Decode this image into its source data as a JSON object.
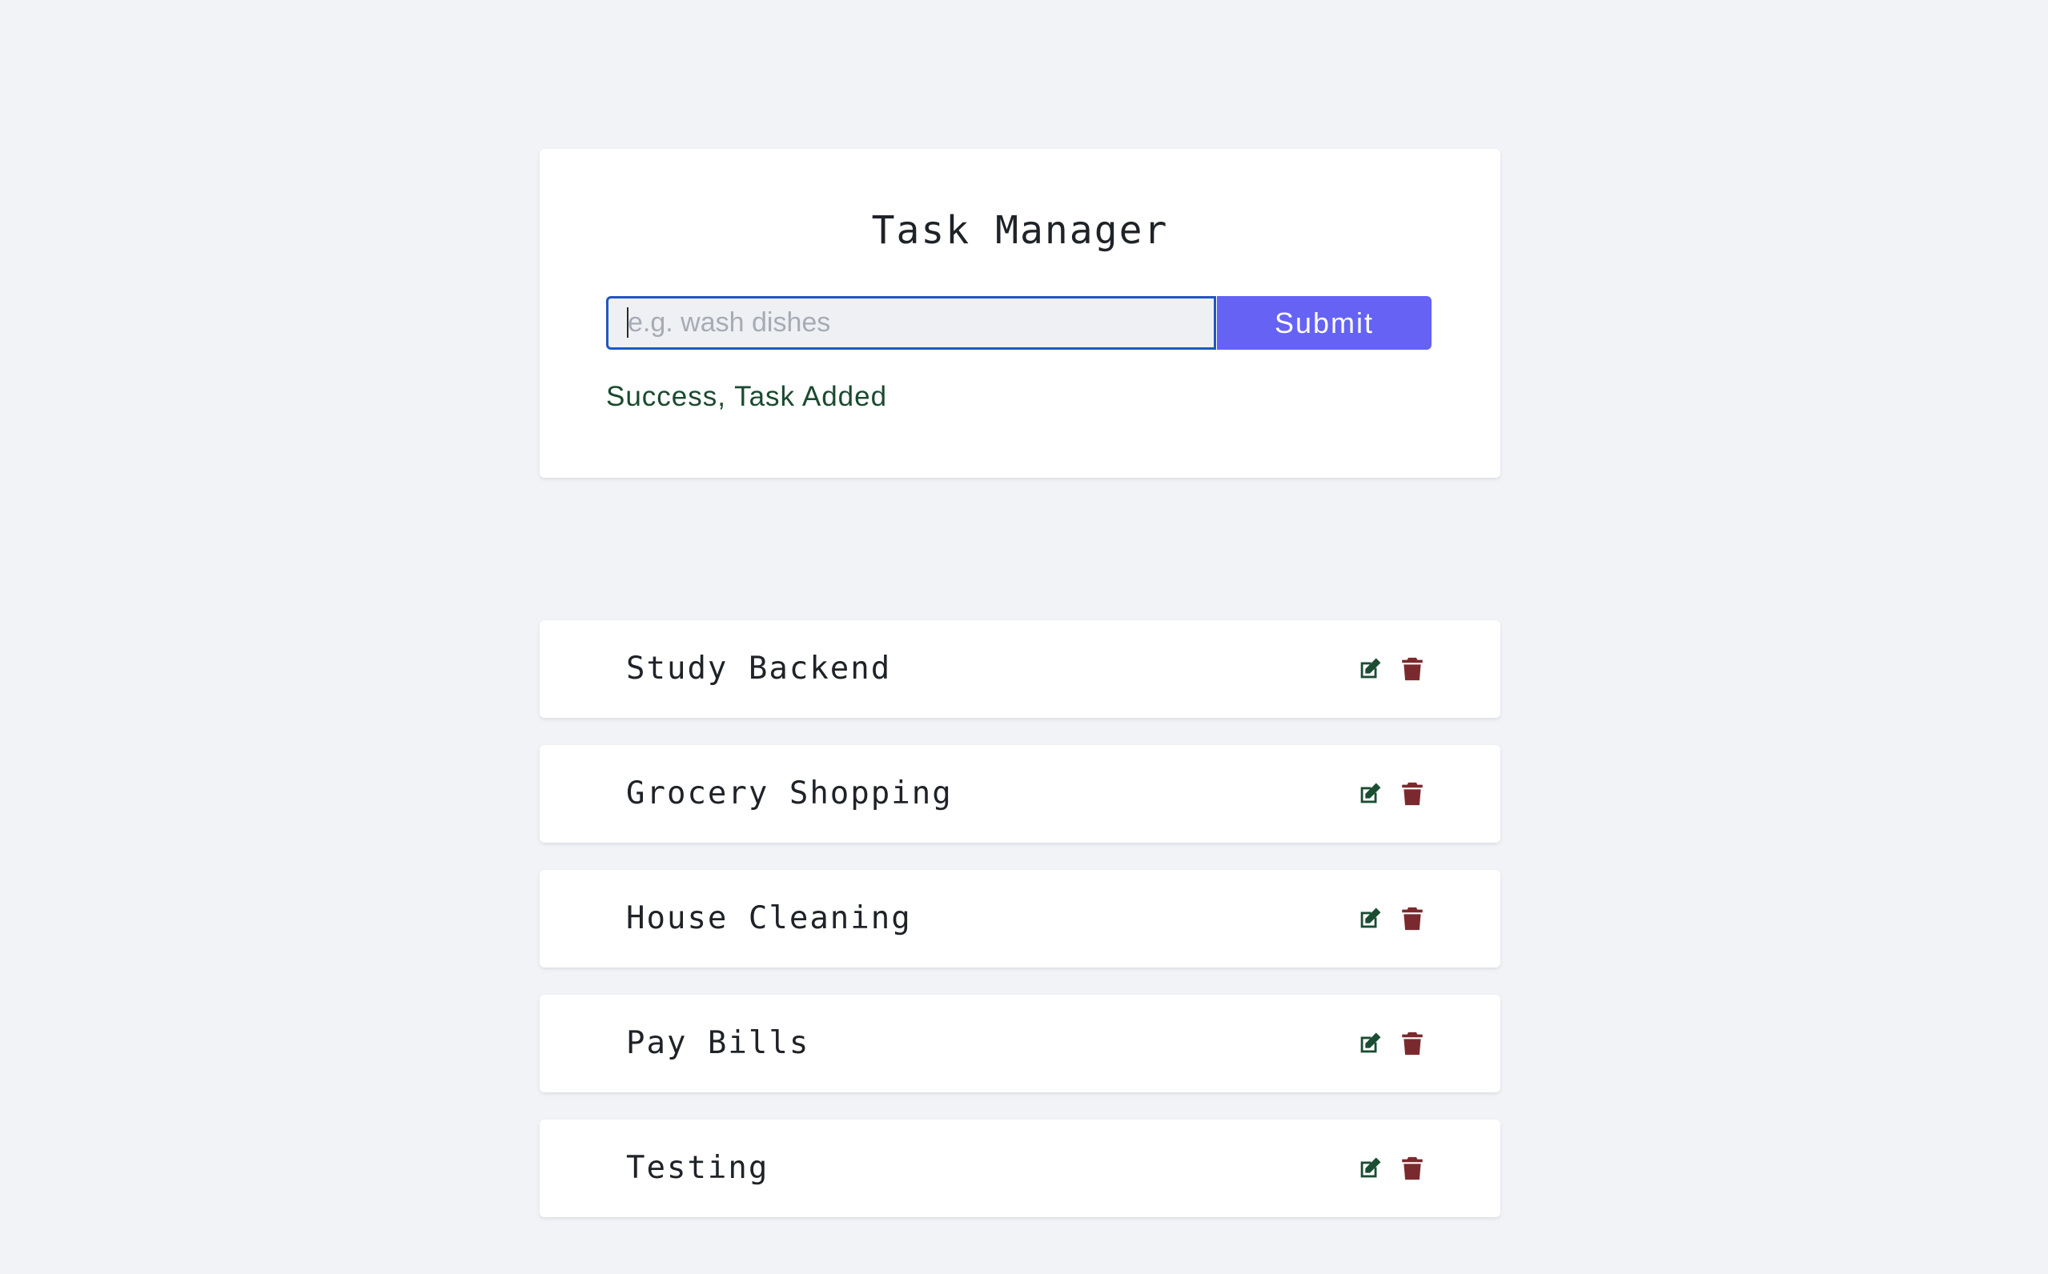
{
  "app": {
    "title": "Task Manager"
  },
  "form": {
    "input_placeholder": "e.g. wash dishes",
    "input_value": "",
    "submit_label": "Submit",
    "alert_text": "Success, Task Added"
  },
  "tasks": [
    {
      "name": "Study Backend",
      "edit_icon": "edit-icon",
      "delete_icon": "trash-icon"
    },
    {
      "name": "Grocery Shopping",
      "edit_icon": "edit-icon",
      "delete_icon": "trash-icon"
    },
    {
      "name": "House Cleaning",
      "edit_icon": "edit-icon",
      "delete_icon": "trash-icon"
    },
    {
      "name": "Pay Bills",
      "edit_icon": "edit-icon",
      "delete_icon": "trash-icon"
    },
    {
      "name": "Testing",
      "edit_icon": "edit-icon",
      "delete_icon": "trash-icon"
    }
  ],
  "colors": {
    "background": "#f1f3f7",
    "accent": "#6562f4",
    "input_focus_border": "#1f57c3",
    "success_text": "#1c4a2f",
    "edit_icon": "#1b4d33",
    "delete_icon": "#7a2a2e"
  }
}
